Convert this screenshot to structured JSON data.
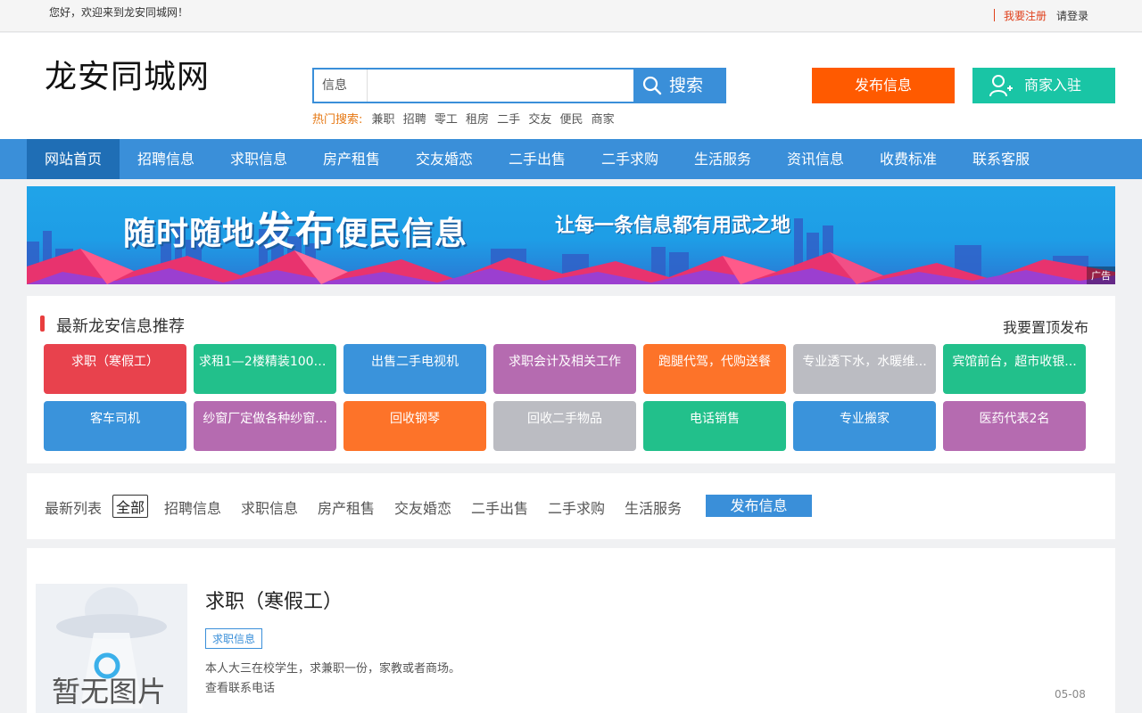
{
  "topbar": {
    "welcome": "您好，欢迎来到龙安同城网！",
    "register": "我要注册",
    "login": "请登录"
  },
  "header": {
    "logo": "龙安同城网",
    "search_category": "信息",
    "search_placeholder": "",
    "search_button": "搜索",
    "hot_label": "热门搜索:",
    "hot_words": [
      "兼职",
      "招聘",
      "零工",
      "租房",
      "二手",
      "交友",
      "便民",
      "商家"
    ],
    "publish_button": "发布信息",
    "merchant_button": "商家入驻"
  },
  "nav": [
    "网站首页",
    "招聘信息",
    "求职信息",
    "房产租售",
    "交友婚恋",
    "二手出售",
    "二手求购",
    "生活服务",
    "资讯信息",
    "收费标准",
    "联系客服"
  ],
  "banner": {
    "headline_a": "随时随地",
    "headline_b": "发布",
    "headline_c": "便民信息",
    "tagline": "让每一条信息都有用武之地",
    "ad_label": "广告"
  },
  "recommend": {
    "title": "最新龙安信息推荐",
    "top_link": "我要置顶发布",
    "tiles": [
      {
        "label": "求职（寒假工）",
        "color": "#e8424d"
      },
      {
        "label": "求租1—2楼精装100平...",
        "color": "#22c08b"
      },
      {
        "label": "出售二手电视机",
        "color": "#3a93db"
      },
      {
        "label": "求职会计及相关工作",
        "color": "#b56bb0"
      },
      {
        "label": "跑腿代驾，代购送餐",
        "color": "#fd7329"
      },
      {
        "label": "专业透下水，水暖维...",
        "color": "#bbbcc2"
      },
      {
        "label": "宾馆前台，超市收银...",
        "color": "#22c08b"
      },
      {
        "label": "客车司机",
        "color": "#3a93db"
      },
      {
        "label": "纱窗厂定做各种纱窗...",
        "color": "#b56bb0"
      },
      {
        "label": "回收钢琴",
        "color": "#fd7329"
      },
      {
        "label": "回收二手物品",
        "color": "#bbbcc2"
      },
      {
        "label": "电话销售",
        "color": "#22c08b"
      },
      {
        "label": "专业搬家",
        "color": "#3a93db"
      },
      {
        "label": "医药代表2名",
        "color": "#b56bb0"
      }
    ]
  },
  "filter": {
    "label": "最新列表",
    "items": [
      "全部",
      "招聘信息",
      "求职信息",
      "房产租售",
      "交友婚恋",
      "二手出售",
      "二手求购",
      "生活服务"
    ],
    "publish": "发布信息"
  },
  "listing": {
    "no_image": "暂无图片",
    "title": "求职（寒假工）",
    "tag": "求职信息",
    "desc": "本人大三在校学生，求兼职一份，家教或者商场。",
    "phone": "查看联系电话",
    "date": "05-08"
  }
}
